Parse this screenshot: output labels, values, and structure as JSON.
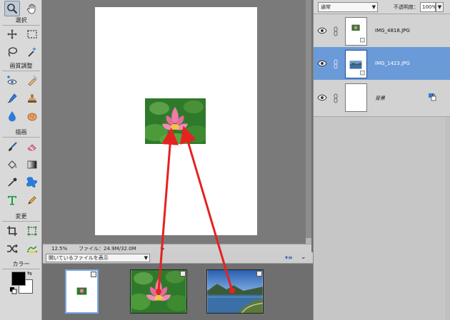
{
  "toolbox": {
    "sections": {
      "select": "選択",
      "enhance": "画質調整",
      "draw": "描画",
      "modify": "変更",
      "color": "カラー"
    },
    "icons": [
      "zoom-icon",
      "hand-icon",
      "move-icon",
      "marquee-icon",
      "lasso-icon",
      "magic-wand-icon",
      "eye-redeye-icon",
      "quick-selection-icon",
      "spot-heal-icon",
      "clone-stamp-icon",
      "blur-icon",
      "sponge-icon",
      "brush-icon",
      "eraser-icon",
      "paint-bucket-icon",
      "gradient-icon",
      "eyedropper-icon",
      "custom-shape-icon",
      "type-icon",
      "pencil-icon",
      "crop-icon",
      "recompose-icon",
      "content-move-icon",
      "straighten-icon"
    ],
    "colors": {
      "foreground": "#000000",
      "background": "#ffffff"
    }
  },
  "status": {
    "zoom": "12.5%",
    "file_info": "ファイル：24.9M/32.0M",
    "arrow": "▶"
  },
  "bin": {
    "dropdown_label": "開いているファイルを表示",
    "menu_icon": "▾≡",
    "collapse_icon": "⌄"
  },
  "layers_panel": {
    "blend_mode": "通常",
    "opacity_label": "不透明度：",
    "opacity_value": "100%",
    "layers": [
      {
        "name": "IMG_4818.JPG",
        "selected": false
      },
      {
        "name": "IMG_1423.JPG",
        "selected": true
      },
      {
        "name": "背景",
        "selected": false
      }
    ]
  },
  "colors": {
    "selection": "#6b9ad8",
    "annotation_arrow": "#e52222",
    "panel_bg": "#cdcdcd",
    "workspace_bg": "#7a7a7a"
  }
}
